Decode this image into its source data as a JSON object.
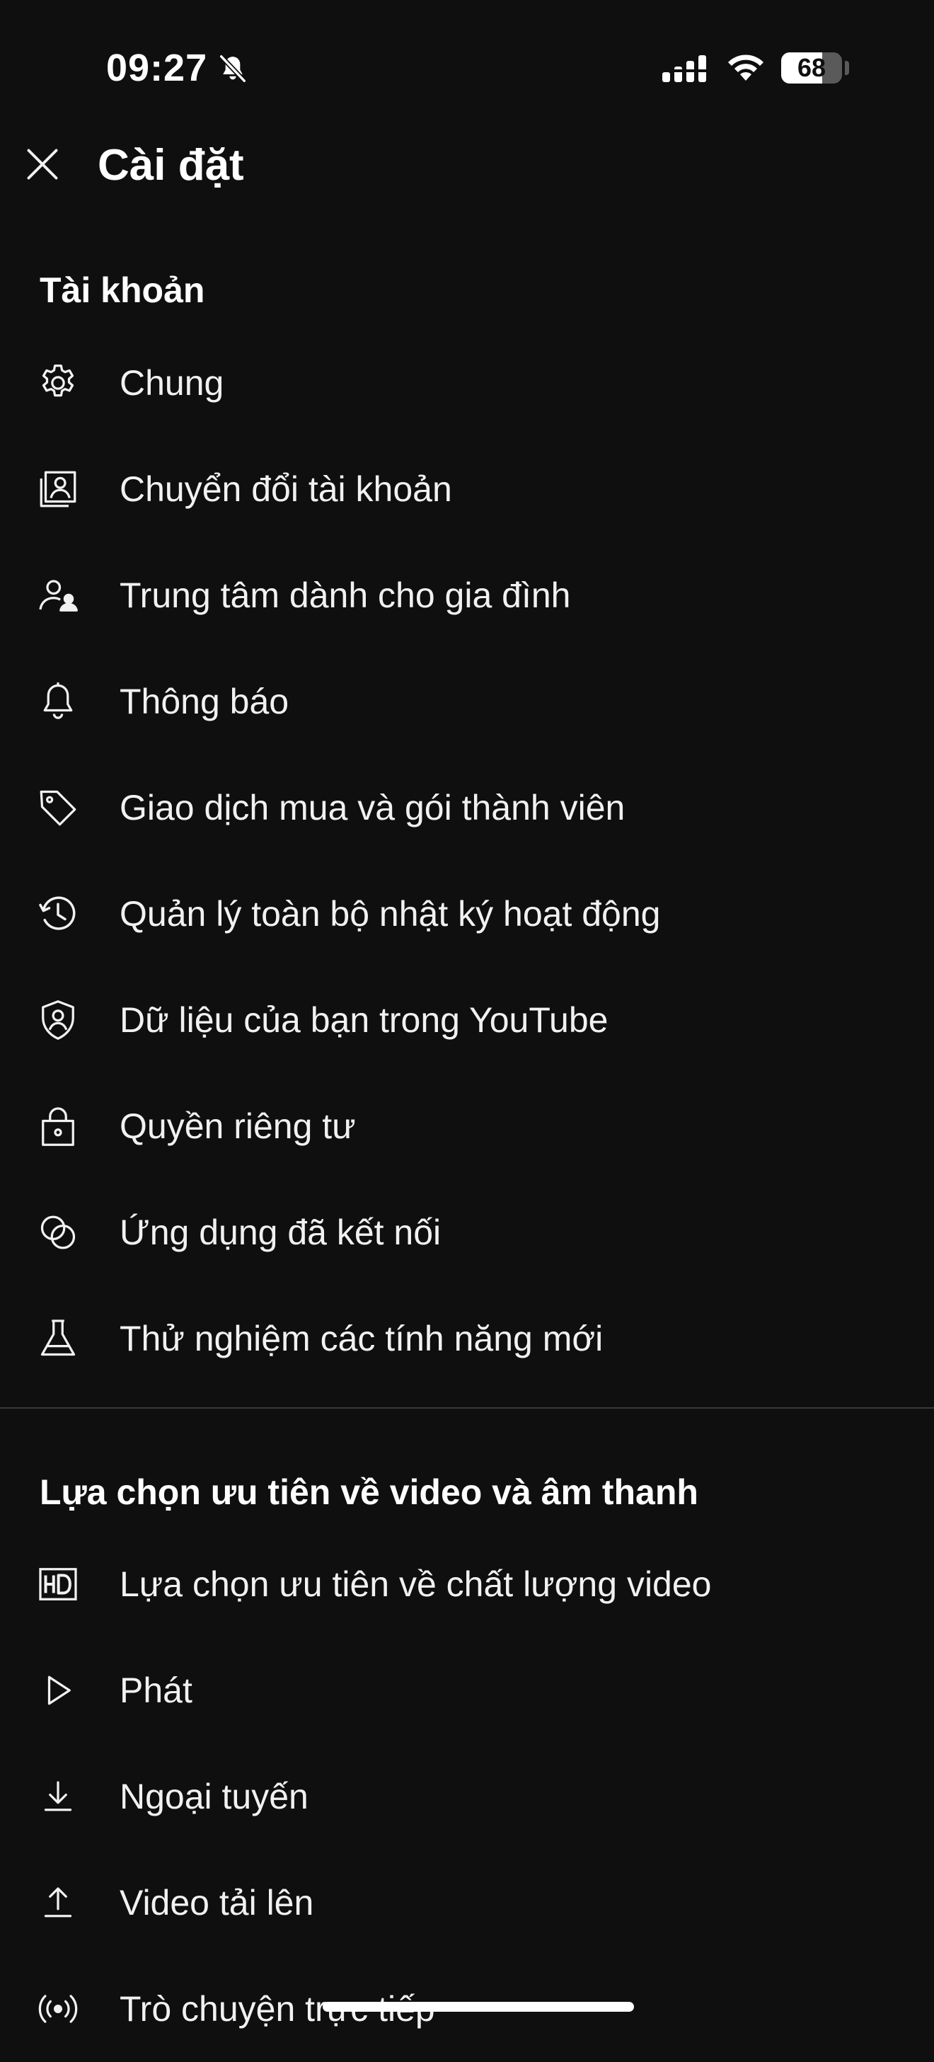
{
  "status_bar": {
    "time": "09:27",
    "battery_level": 68,
    "battery_text": "68",
    "icons": [
      "bell-slash-icon",
      "cellular-signal-icon",
      "wifi-icon",
      "battery-icon"
    ]
  },
  "header": {
    "title": "Cài đặt",
    "close_icon": "close-icon"
  },
  "sections": {
    "account": {
      "heading": "Tài khoản",
      "items": [
        {
          "label": "Chung",
          "icon": "gear-icon"
        },
        {
          "label": "Chuyển đổi tài khoản",
          "icon": "switch-account-icon"
        },
        {
          "label": "Trung tâm dành cho gia đình",
          "icon": "family-center-icon"
        },
        {
          "label": "Thông báo",
          "icon": "bell-icon"
        },
        {
          "label": "Giao dịch mua và gói thành viên",
          "icon": "tag-icon"
        },
        {
          "label": "Quản lý toàn bộ nhật ký hoạt động",
          "icon": "history-icon"
        },
        {
          "label": "Dữ liệu của bạn trong YouTube",
          "icon": "shield-person-icon"
        },
        {
          "label": "Quyền riêng tư",
          "icon": "lock-icon"
        },
        {
          "label": "Ứng dụng đã kết nối",
          "icon": "connected-apps-icon"
        },
        {
          "label": "Thử nghiệm các tính năng mới",
          "icon": "flask-icon"
        }
      ]
    },
    "video_audio": {
      "heading": "Lựa chọn ưu tiên về video và âm thanh",
      "items": [
        {
          "label": "Lựa chọn ưu tiên về chất lượng video",
          "icon": "hd-icon"
        },
        {
          "label": "Phát",
          "icon": "play-icon"
        },
        {
          "label": "Ngoại tuyến",
          "icon": "download-icon"
        },
        {
          "label": "Video tải lên",
          "icon": "upload-icon"
        },
        {
          "label": "Trò chuyện trực tiếp",
          "icon": "live-icon"
        }
      ]
    }
  },
  "colors": {
    "background": "#0f0f0f",
    "text": "#f1f1f1",
    "divider": "#3a3a3a"
  }
}
